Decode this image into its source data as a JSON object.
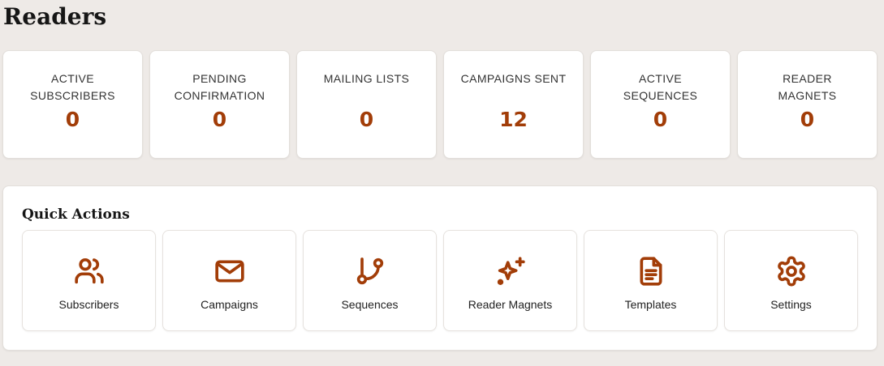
{
  "page": {
    "title": "Readers"
  },
  "stats": [
    {
      "label": "Active Subscribers",
      "value": "0"
    },
    {
      "label": "Pending Confirmation",
      "value": "0"
    },
    {
      "label": "Mailing Lists",
      "value": "0"
    },
    {
      "label": "Campaigns Sent",
      "value": "12"
    },
    {
      "label": "Active Sequences",
      "value": "0"
    },
    {
      "label": "Reader Magnets",
      "value": "0"
    }
  ],
  "quick_actions": {
    "title": "Quick Actions",
    "items": [
      {
        "label": "Subscribers",
        "icon": "users-icon"
      },
      {
        "label": "Campaigns",
        "icon": "mail-icon"
      },
      {
        "label": "Sequences",
        "icon": "git-branch-icon"
      },
      {
        "label": "Reader Magnets",
        "icon": "sparkles-icon"
      },
      {
        "label": "Templates",
        "icon": "document-icon"
      },
      {
        "label": "Settings",
        "icon": "gear-icon"
      }
    ]
  },
  "colors": {
    "accent": "#a23d08",
    "background": "#eeeae7",
    "card": "#ffffff"
  }
}
